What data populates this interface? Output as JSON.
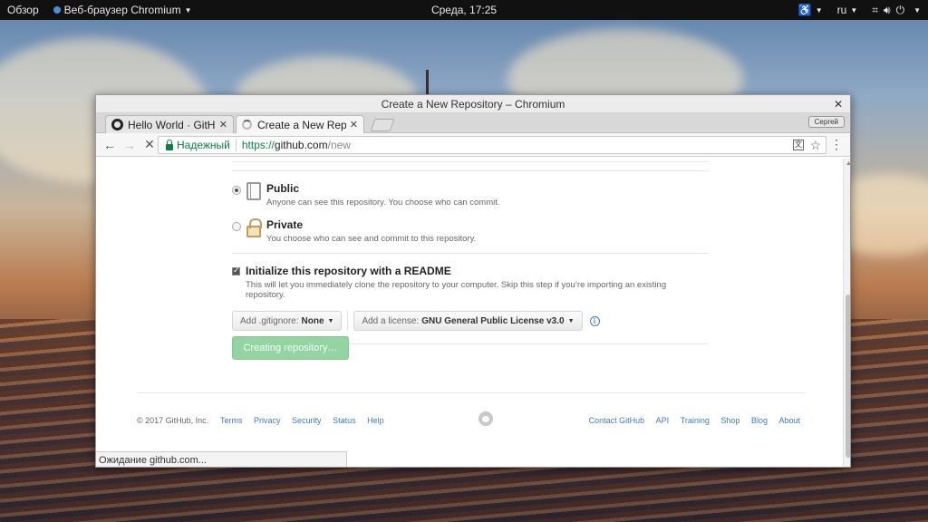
{
  "topbar": {
    "activities": "Обзор",
    "app_name": "Веб-браузер Chromium",
    "clock": "Среда, 17:25",
    "language": "ru"
  },
  "window": {
    "title": "Create a New Repository – Chromium"
  },
  "tabs": [
    {
      "title": "Hello World · GitHub",
      "active": false
    },
    {
      "title": "Create a New Repository",
      "active": true
    }
  ],
  "profile_button": "Сергей",
  "omnibox": {
    "secure_label": "Надежный",
    "url_scheme": "https://",
    "url_host": "github.com",
    "url_path": "/new"
  },
  "visibility": {
    "public": {
      "title": "Public",
      "description": "Anyone can see this repository. You choose who can commit.",
      "selected": true
    },
    "private": {
      "title": "Private",
      "description": "You choose who can see and commit to this repository.",
      "selected": false
    }
  },
  "readme": {
    "title": "Initialize this repository with a README",
    "description": "This will let you immediately clone the repository to your computer. Skip this step if you’re importing an existing repository.",
    "checked": true
  },
  "gitignore": {
    "label": "Add .gitignore:",
    "value": "None"
  },
  "license": {
    "label": "Add a license:",
    "value": "GNU General Public License v3.0"
  },
  "create_button": "Creating repository…",
  "footer": {
    "copyright": "© 2017 GitHub, Inc.",
    "links_left": [
      "Terms",
      "Privacy",
      "Security",
      "Status",
      "Help"
    ],
    "links_right": [
      "Contact GitHub",
      "API",
      "Training",
      "Shop",
      "Blog",
      "About"
    ]
  },
  "status_bubble": "Ожидание github.com..."
}
